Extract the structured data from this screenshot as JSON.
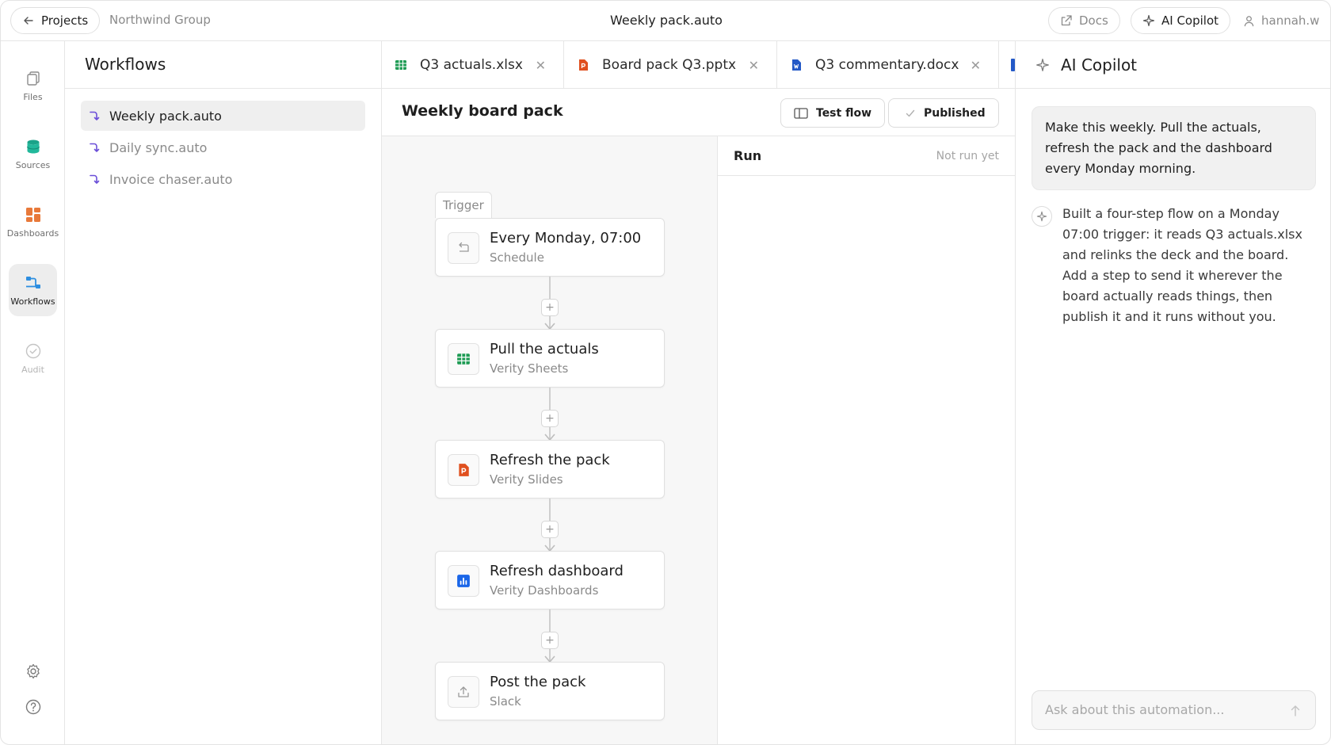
{
  "topbar": {
    "back_label": "Projects",
    "org": "Northwind Group",
    "title": "Weekly pack.auto",
    "docs_label": "Docs",
    "copilot_label": "AI Copilot",
    "user": "hannah.w"
  },
  "rail": {
    "items": [
      {
        "label": "Files",
        "icon": "files-icon"
      },
      {
        "label": "Sources",
        "icon": "database-icon"
      },
      {
        "label": "Dashboards",
        "icon": "dashboard-icon"
      },
      {
        "label": "Workflows",
        "icon": "workflow-icon",
        "active": true
      },
      {
        "label": "Audit",
        "icon": "check-circle-icon",
        "disabled": true
      }
    ],
    "bottom": [
      "settings-icon",
      "help-icon"
    ]
  },
  "workflows": {
    "title": "Workflows",
    "items": [
      {
        "label": "Weekly pack.auto",
        "active": true
      },
      {
        "label": "Daily sync.auto"
      },
      {
        "label": "Invoice chaser.auto"
      }
    ]
  },
  "tabs": [
    {
      "label": "Q3 actuals.xlsx",
      "icon": "spreadsheet-icon",
      "color": "#1e9b54"
    },
    {
      "label": "Board pack Q3.pptx",
      "icon": "presentation-icon",
      "color": "#e0501f"
    },
    {
      "label": "Q3 commentary.docx",
      "icon": "document-icon",
      "color": "#2459c7"
    }
  ],
  "flow": {
    "title": "Weekly board pack",
    "test_label": "Test flow",
    "published_label": "Published",
    "trigger_tag": "Trigger",
    "nodes": [
      {
        "title": "Every Monday, 07:00",
        "subtitle": "Schedule",
        "icon": "schedule-icon"
      },
      {
        "title": "Pull the actuals",
        "subtitle": "Verity Sheets",
        "icon": "spreadsheet-icon"
      },
      {
        "title": "Refresh the pack",
        "subtitle": "Verity Slides",
        "icon": "presentation-icon"
      },
      {
        "title": "Refresh dashboard",
        "subtitle": "Verity Dashboards",
        "icon": "bar-chart-icon"
      },
      {
        "title": "Post the pack",
        "subtitle": "Slack",
        "icon": "upload-icon"
      }
    ],
    "add_step": "+"
  },
  "run": {
    "title": "Run",
    "status": "Not run yet"
  },
  "copilot": {
    "title": "AI Copilot",
    "user_message": "Make this weekly. Pull the actuals, refresh the pack and the dashboard every Monday morning.",
    "ai_message": "Built a four-step flow on a Monday 07:00 trigger: it reads Q3 actuals.xlsx and relinks the deck and the board. Add a step to send it wherever the board actually reads things, then publish it and it runs without you.",
    "placeholder": "Ask about this automation..."
  },
  "colors": {
    "workflow_accent": "#6b4fd8",
    "sheets_green": "#1e9b54",
    "slides_orange": "#e0501f",
    "docs_blue": "#2459c7",
    "dashboard_blue": "#1a66e8"
  }
}
